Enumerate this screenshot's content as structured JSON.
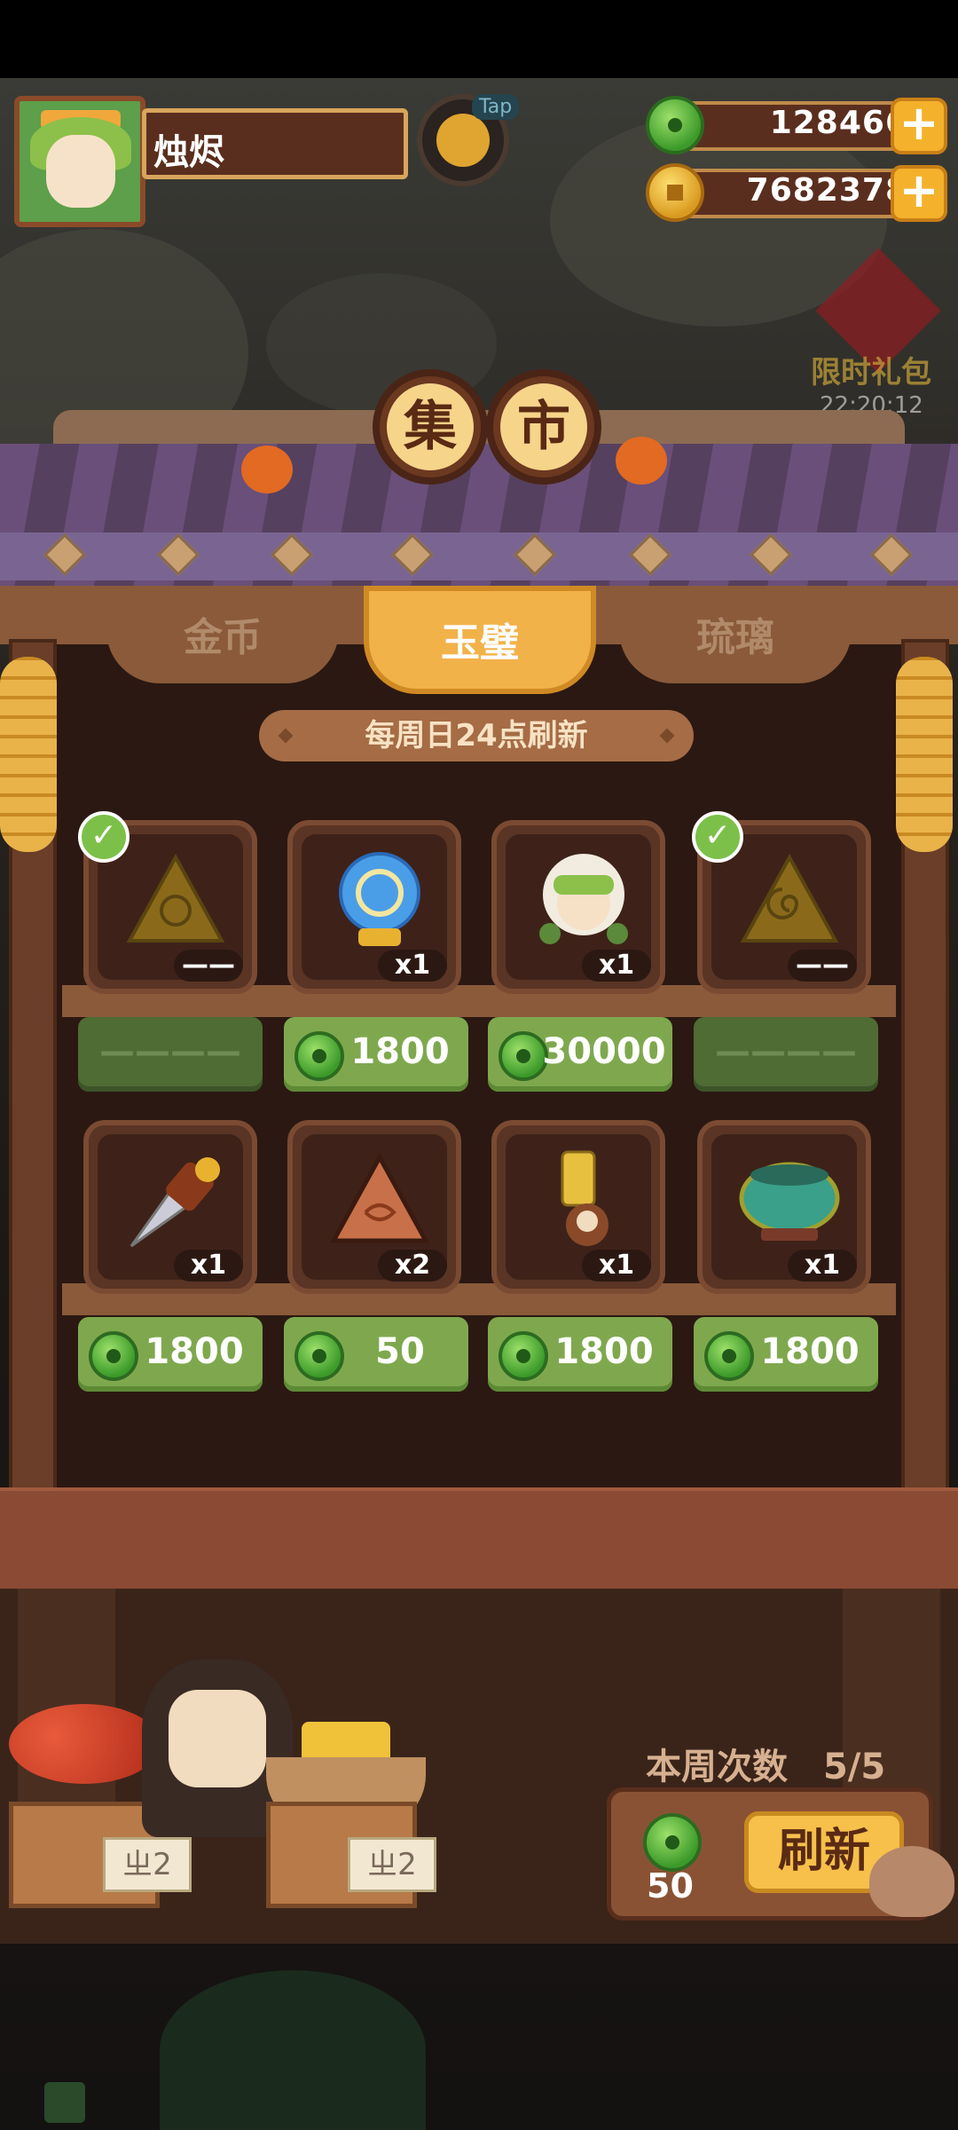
{
  "player": {
    "name": "烛烬"
  },
  "resources": {
    "jade": "128466",
    "gold": "7682378"
  },
  "top": {
    "tap_label": "Tap"
  },
  "gift": {
    "label": "限时礼包",
    "timer": "22:20:12"
  },
  "market": {
    "title_left": "集",
    "title_right": "市"
  },
  "tabs": [
    {
      "label": "金币",
      "active": false
    },
    {
      "label": "玉璧",
      "active": true
    },
    {
      "label": "琉璃",
      "active": false
    }
  ],
  "refresh_note": "每周日24点刷新",
  "items_row1": [
    {
      "name": "turtle-shard",
      "qty": "——",
      "price": "————",
      "sold": true
    },
    {
      "name": "blue-conch",
      "qty": "x1",
      "price": "1800",
      "sold": false
    },
    {
      "name": "girl-figure",
      "qty": "x1",
      "price": "30000",
      "sold": false
    },
    {
      "name": "spiral-shard",
      "qty": "——",
      "price": "————",
      "sold": true
    }
  ],
  "items_row2": [
    {
      "name": "drill-tool",
      "qty": "x1",
      "price": "1800",
      "sold": false
    },
    {
      "name": "clay-shard",
      "qty": "x2",
      "price": "50",
      "sold": false
    },
    {
      "name": "daruma-key",
      "qty": "x1",
      "price": "1800",
      "sold": false
    },
    {
      "name": "jade-cauldron",
      "qty": "x1",
      "price": "1800",
      "sold": false
    }
  ],
  "weekly": {
    "label": "本周次数",
    "value": "5/5"
  },
  "refresh": {
    "cost": "50",
    "button_label": "刷新"
  },
  "signs": {
    "left": "ㄓ2",
    "right": "ㄓ2"
  },
  "colors": {
    "jade": "#5cb33a",
    "gold": "#e0a020",
    "price_green": "#7fa84e",
    "tab_active": "#f2b24a"
  }
}
